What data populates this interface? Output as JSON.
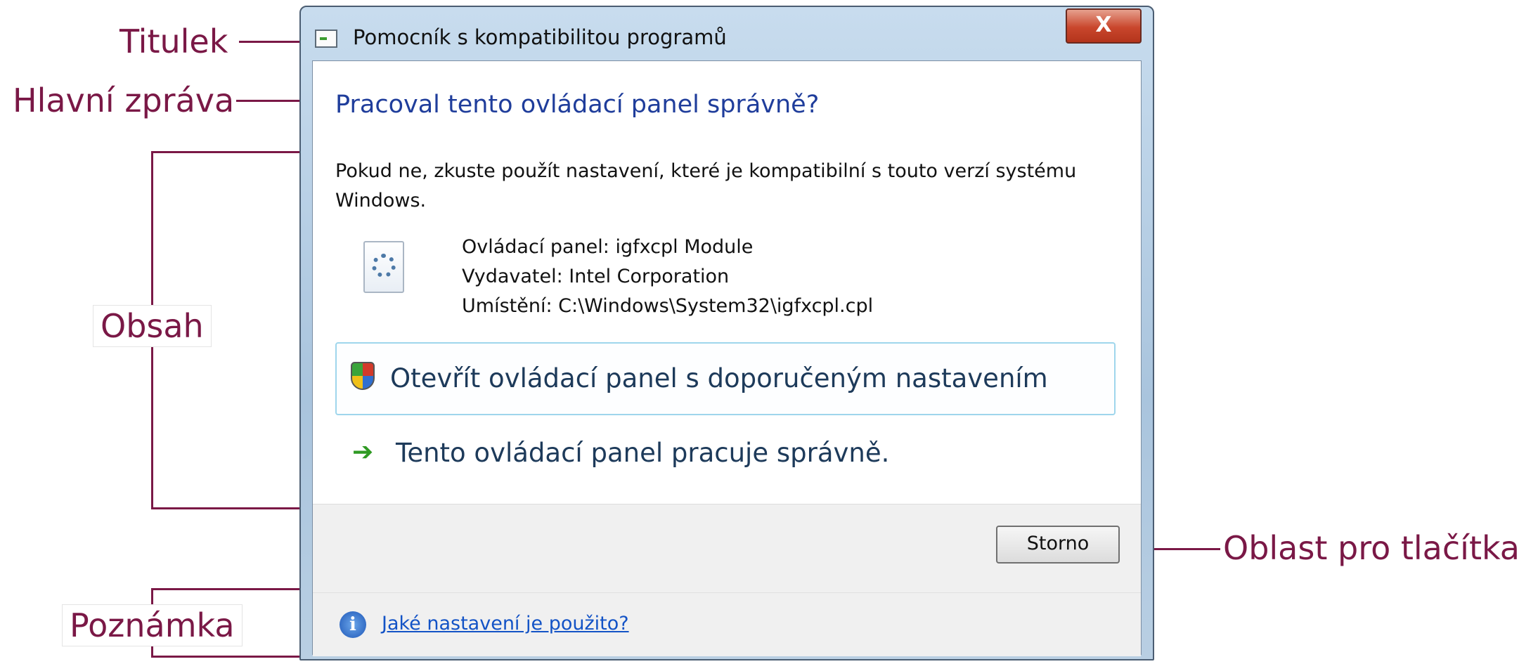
{
  "annotations": {
    "titulek": "Titulek",
    "hlavni_zprava": "Hlavní zpráva",
    "obsah": "Obsah",
    "poznamka": "Poznámka",
    "oblast_tlacitka": "Oblast pro tlačítka"
  },
  "dialog": {
    "title": "Pomocník s kompatibilitou programů",
    "close_label": "X",
    "main_instruction": "Pracoval tento ovládací panel správně?",
    "content_text": "Pokud ne, zkuste použít nastavení, které je kompatibilní s touto verzí systému Windows.",
    "file_info": [
      "Ovládací panel: igfxcpl Module",
      "Vydavatel: Intel Corporation",
      "Umístění: C:\\Windows\\System32\\igfxcpl.cpl"
    ],
    "command_recommended": "Otevřít ovládací panel s doporučeným nastavením",
    "command_ok": "Tento ovládací panel pracuje správně.",
    "cancel_button": "Storno",
    "footnote_link": "Jaké nastavení je použito?"
  },
  "colors": {
    "annotation": "#7a1846",
    "main_instruction": "#1f3d9b",
    "link": "#1353c6"
  },
  "icons": [
    "program-icon",
    "close-icon",
    "settings-file-icon",
    "uac-shield-icon",
    "green-arrow-icon",
    "info-icon"
  ]
}
